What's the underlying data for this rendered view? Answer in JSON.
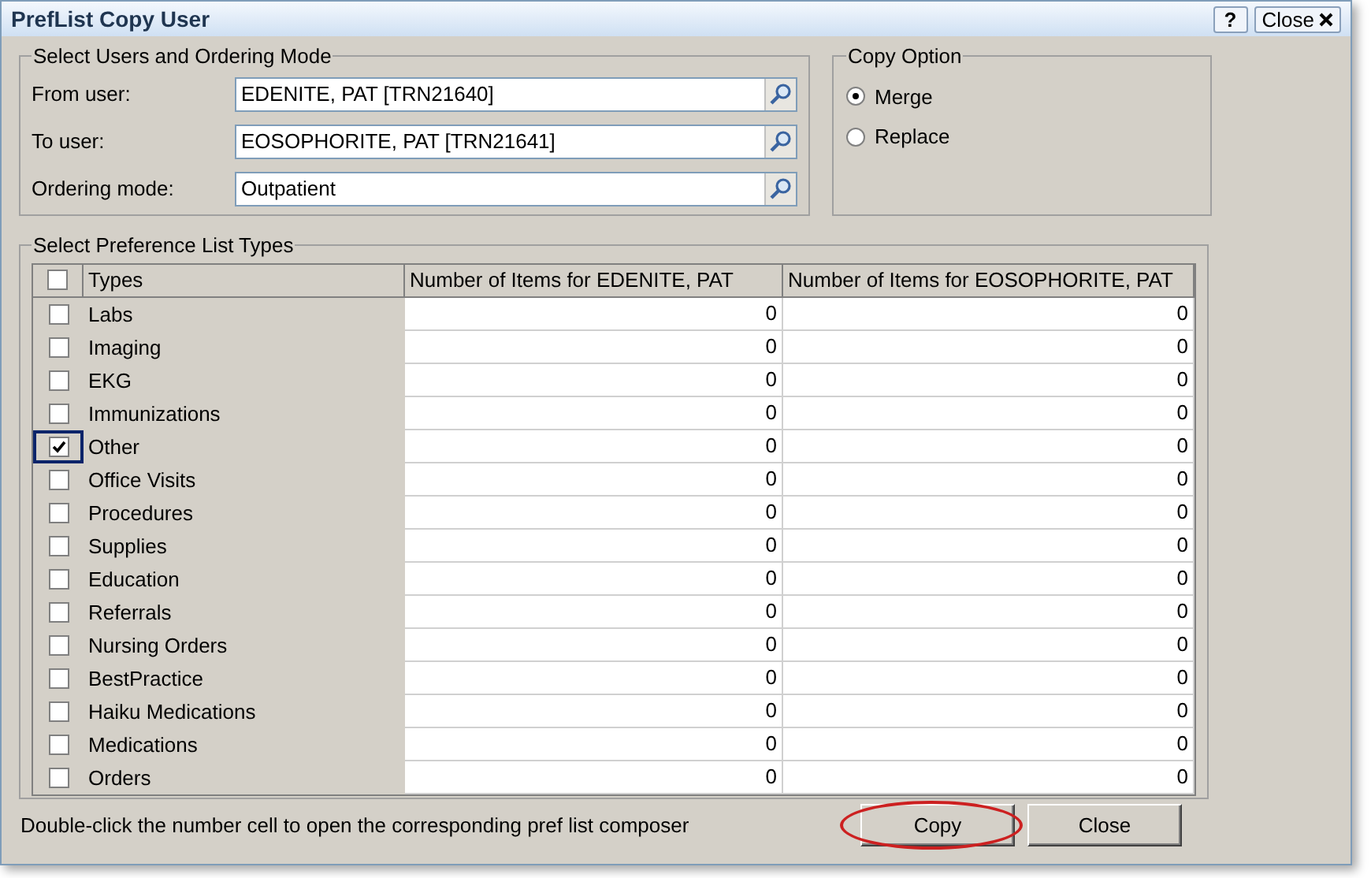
{
  "window": {
    "title": "PrefList Copy User",
    "help_button": "?",
    "close_button": "Close"
  },
  "users_group": {
    "legend": "Select Users and Ordering Mode",
    "fields": [
      {
        "label": "From user:",
        "value": "EDENITE, PAT [TRN21640]"
      },
      {
        "label": "To user:",
        "value": "EOSOPHORITE, PAT [TRN21641]"
      },
      {
        "label": "Ordering mode:",
        "value": "Outpatient"
      }
    ]
  },
  "copy_option": {
    "legend": "Copy Option",
    "options": [
      {
        "label": "Merge",
        "selected": true
      },
      {
        "label": "Replace",
        "selected": false
      }
    ]
  },
  "types_group": {
    "legend": "Select Preference List Types",
    "table": {
      "select_all_checked": false,
      "columns": [
        "Types",
        "Number of Items for EDENITE, PAT",
        "Number of Items for EOSOPHORITE, PAT"
      ],
      "rows": [
        {
          "type": "Labs",
          "from": "0",
          "to": "0",
          "checked": false,
          "focused": false
        },
        {
          "type": "Imaging",
          "from": "0",
          "to": "0",
          "checked": false,
          "focused": false
        },
        {
          "type": "EKG",
          "from": "0",
          "to": "0",
          "checked": false,
          "focused": false
        },
        {
          "type": "Immunizations",
          "from": "0",
          "to": "0",
          "checked": false,
          "focused": false
        },
        {
          "type": "Other",
          "from": "0",
          "to": "0",
          "checked": true,
          "focused": true
        },
        {
          "type": "Office Visits",
          "from": "0",
          "to": "0",
          "checked": false,
          "focused": false
        },
        {
          "type": "Procedures",
          "from": "0",
          "to": "0",
          "checked": false,
          "focused": false
        },
        {
          "type": "Supplies",
          "from": "0",
          "to": "0",
          "checked": false,
          "focused": false
        },
        {
          "type": "Education",
          "from": "0",
          "to": "0",
          "checked": false,
          "focused": false
        },
        {
          "type": "Referrals",
          "from": "0",
          "to": "0",
          "checked": false,
          "focused": false
        },
        {
          "type": "Nursing Orders",
          "from": "0",
          "to": "0",
          "checked": false,
          "focused": false
        },
        {
          "type": "BestPractice",
          "from": "0",
          "to": "0",
          "checked": false,
          "focused": false
        },
        {
          "type": "Haiku Medications",
          "from": "0",
          "to": "0",
          "checked": false,
          "focused": false
        },
        {
          "type": "Medications",
          "from": "0",
          "to": "0",
          "checked": false,
          "focused": false
        },
        {
          "type": "Orders",
          "from": "0",
          "to": "0",
          "checked": false,
          "focused": false
        }
      ]
    }
  },
  "hint": "Double-click the number cell to open the corresponding pref list composer",
  "buttons": [
    {
      "label": "Copy",
      "circled": true
    },
    {
      "label": "Close",
      "circled": false
    }
  ]
}
